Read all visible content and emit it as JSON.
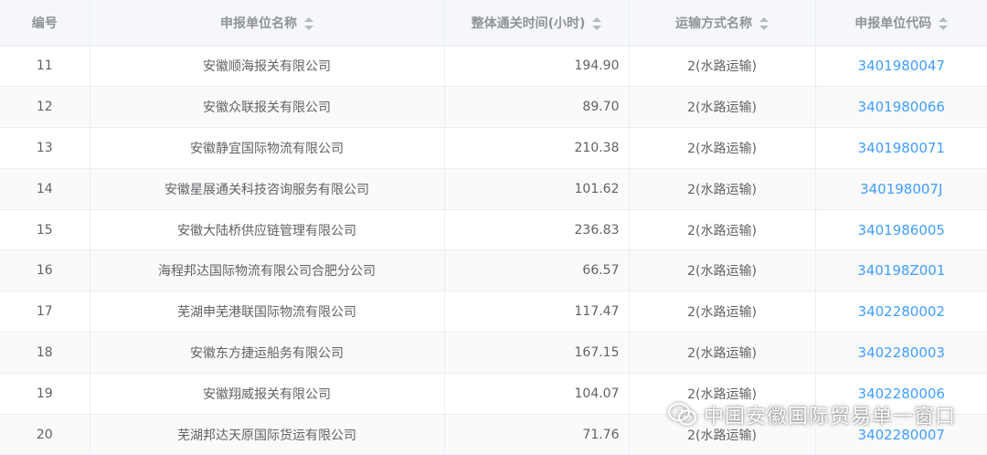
{
  "table": {
    "headers": [
      {
        "label": "编号",
        "sortable": false
      },
      {
        "label": "申报单位名称",
        "sortable": true
      },
      {
        "label": "整体通关时间(小时)",
        "sortable": true
      },
      {
        "label": "运输方式名称",
        "sortable": true
      },
      {
        "label": "申报单位代码",
        "sortable": true
      }
    ],
    "rows": [
      {
        "id": "11",
        "name": "安徽顺海报关有限公司",
        "time": "194.90",
        "mode": "2(水路运输)",
        "code": "3401980047"
      },
      {
        "id": "12",
        "name": "安徽众联报关有限公司",
        "time": "89.70",
        "mode": "2(水路运输)",
        "code": "3401980066"
      },
      {
        "id": "13",
        "name": "安徽静宜国际物流有限公司",
        "time": "210.38",
        "mode": "2(水路运输)",
        "code": "3401980071"
      },
      {
        "id": "14",
        "name": "安徽星展通关科技咨询服务有限公司",
        "time": "101.62",
        "mode": "2(水路运输)",
        "code": "340198007J"
      },
      {
        "id": "15",
        "name": "安徽大陆桥供应链管理有限公司",
        "time": "236.83",
        "mode": "2(水路运输)",
        "code": "3401986005"
      },
      {
        "id": "16",
        "name": "海程邦达国际物流有限公司合肥分公司",
        "time": "66.57",
        "mode": "2(水路运输)",
        "code": "340198Z001"
      },
      {
        "id": "17",
        "name": "芜湖申芜港联国际物流有限公司",
        "time": "117.47",
        "mode": "2(水路运输)",
        "code": "3402280002"
      },
      {
        "id": "18",
        "name": "安徽东方捷运船务有限公司",
        "time": "167.15",
        "mode": "2(水路运输)",
        "code": "3402280003"
      },
      {
        "id": "19",
        "name": "安徽翔威报关有限公司",
        "time": "104.07",
        "mode": "2(水路运输)",
        "code": "3402280006"
      },
      {
        "id": "20",
        "name": "芜湖邦达天原国际货运有限公司",
        "time": "71.76",
        "mode": "2(水路运输)",
        "code": "3402280007"
      }
    ]
  },
  "watermark": {
    "text": "中国安徽国际贸易单一窗口",
    "icon": "wechat-icon"
  }
}
